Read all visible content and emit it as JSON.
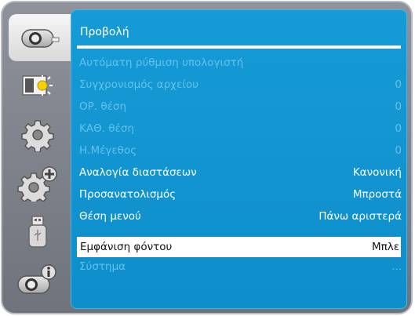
{
  "menu": {
    "title": "Προβολή",
    "items": [
      {
        "label": "Αυτόματη ρύθμιση υπολογιστή",
        "value": "",
        "state": "disabled"
      },
      {
        "label": "Συγχρονισμός αρχείου",
        "value": "0",
        "state": "disabled"
      },
      {
        "label": "ΟΡ. θέση",
        "value": "0",
        "state": "disabled"
      },
      {
        "label": "ΚΑΘ. θέση",
        "value": "0",
        "state": "disabled"
      },
      {
        "label": "Η.Μέγεθος",
        "value": "0",
        "state": "disabled"
      },
      {
        "label": "Αναλογία διαστάσεων",
        "value": "Κανονική",
        "state": "enabled"
      },
      {
        "label": "Προσανατολισμός",
        "value": "Μπροστά",
        "state": "enabled"
      },
      {
        "label": "Θέση μενού",
        "value": "Πάνω αριστερά",
        "state": "enabled"
      },
      {
        "label": "Εμφάνιση φόντου",
        "value": "Μπλε",
        "state": "selected"
      },
      {
        "label": "Σύστημα",
        "value": "...",
        "state": "disabled"
      }
    ]
  },
  "sidebar": {
    "items": [
      {
        "icon": "projector-icon",
        "active": true
      },
      {
        "icon": "picture-brightness-icon",
        "active": false
      },
      {
        "icon": "gear-icon",
        "active": false
      },
      {
        "icon": "gear-plus-icon",
        "active": false
      },
      {
        "icon": "usb-icon",
        "active": false
      },
      {
        "icon": "projector-info-icon",
        "active": false
      }
    ]
  },
  "colors": {
    "panel_blue": "#1399d4",
    "disabled_text": "#63c1ea",
    "frame_gray": "#7f838b",
    "selected_bg": "#ffffff"
  }
}
